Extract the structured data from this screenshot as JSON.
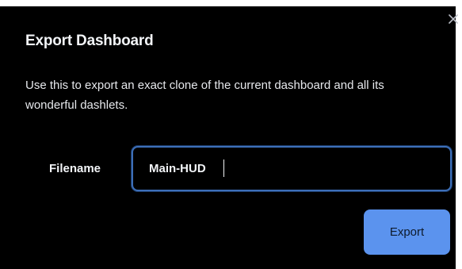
{
  "dialog": {
    "title": "Export Dashboard",
    "description": "Use this to export an exact clone of the current dashboard and all its wonderful dashlets.",
    "close_icon": "close-icon",
    "filename_label": "Filename",
    "filename_value": "Main-HUD",
    "export_label": "Export"
  },
  "colors": {
    "panel_background": "#000000",
    "accent": "#5b93ee",
    "input_border": "#3d6fb8"
  }
}
